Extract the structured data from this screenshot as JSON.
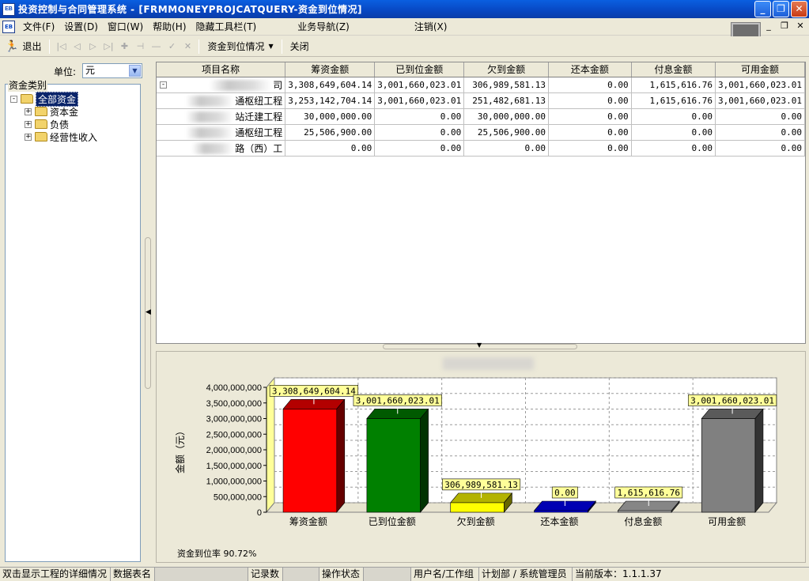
{
  "window": {
    "title": "投资控制与合同管理系统 - [FRMMONEYPROJCATQUERY-资金到位情况]",
    "icon_text": "EB",
    "buttons": [
      "minimize-icon",
      "restore-icon",
      "close-icon"
    ]
  },
  "menu": {
    "items": [
      "文件(F)",
      "设置(D)",
      "窗口(W)",
      "帮助(H)",
      "隐藏工具栏(T)",
      "业务导航(Z)",
      "注销(X)"
    ]
  },
  "toolbar": {
    "exit_label": "退出",
    "dropdown_label": "资金到位情况",
    "close_label": "关闭",
    "nav_icons": [
      "first-icon",
      "prev-icon",
      "next-icon",
      "last-icon",
      "add-icon",
      "delete-icon",
      "edit-icon",
      "confirm-icon",
      "cancel-icon"
    ]
  },
  "left": {
    "unit_label": "单位:",
    "unit_value": "元",
    "group_label": "资金类别",
    "tree": [
      {
        "label": "全部资金",
        "expander": "-"
      },
      {
        "label": "资本金",
        "expander": "+"
      },
      {
        "label": "负债",
        "expander": "+"
      },
      {
        "label": "经营性收入",
        "expander": "+"
      }
    ]
  },
  "grid": {
    "columns": [
      "项目名称",
      "筹资金额",
      "已到位金额",
      "欠到金额",
      "还本金额",
      "付息金额",
      "可用金额"
    ],
    "rows": [
      {
        "name": "司",
        "expander": "-",
        "values": [
          "3,308,649,604.14",
          "3,001,660,023.01",
          "306,989,581.13",
          "0.00",
          "1,615,616.76",
          "3,001,660,023.01"
        ]
      },
      {
        "name": "通枢纽工程",
        "values": [
          "3,253,142,704.14",
          "3,001,660,023.01",
          "251,482,681.13",
          "0.00",
          "1,615,616.76",
          "3,001,660,023.01"
        ]
      },
      {
        "name": "站迁建工程",
        "values": [
          "30,000,000.00",
          "0.00",
          "30,000,000.00",
          "0.00",
          "0.00",
          "0.00"
        ]
      },
      {
        "name": "通枢纽工程",
        "values": [
          "25,506,900.00",
          "0.00",
          "25,506,900.00",
          "0.00",
          "0.00",
          "0.00"
        ]
      },
      {
        "name": "路（西）工",
        "values": [
          "0.00",
          "0.00",
          "0.00",
          "0.00",
          "0.00",
          "0.00"
        ]
      }
    ]
  },
  "chart_data": {
    "type": "bar",
    "title": "",
    "xlabel": "",
    "ylabel": "金额（元）",
    "ylim": [
      0,
      4000000000
    ],
    "yticks": [
      0,
      500000000,
      1000000000,
      1500000000,
      2000000000,
      2500000000,
      3000000000,
      3500000000,
      4000000000
    ],
    "ytick_labels": [
      "0",
      "500,000,000",
      "1,000,000,000",
      "1,500,000,000",
      "2,000,000,000",
      "2,500,000,000",
      "3,000,000,000",
      "3,500,000,000",
      "4,000,000,000"
    ],
    "categories": [
      "筹资金额",
      "已到位金额",
      "欠到金额",
      "还本金额",
      "付息金额",
      "可用金额"
    ],
    "values": [
      3308649604.14,
      3001660023.01,
      306989581.13,
      0.0,
      1615616.76,
      3001660023.01
    ],
    "data_labels": [
      "3,308,649,604.14",
      "3,001,660,023.01",
      "306,989,581.13",
      "0.00",
      "1,615,616.76",
      "3,001,660,023.01"
    ],
    "colors": [
      "#ff0000",
      "#008000",
      "#ffff00",
      "#0000ff",
      "#c0c0c0",
      "#808080"
    ],
    "grid": true,
    "three_d": true
  },
  "rate": {
    "label": "资金到位率",
    "value": "90.72%"
  },
  "status": {
    "hint": "双击显示工程的详细情况",
    "table_name": "数据表名",
    "record_count": "记录数",
    "op_state": "操作状态",
    "user_group": "用户名/工作组",
    "user": "计划部 / 系统管理员",
    "version": "当前版本：1.1.1.37"
  }
}
